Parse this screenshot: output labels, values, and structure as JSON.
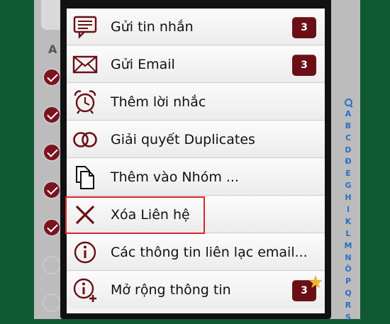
{
  "background": {
    "section_letter": "A"
  },
  "index": [
    "A",
    "B",
    "C",
    "D",
    "Đ",
    "E",
    "G",
    "H",
    "I",
    "K",
    "L",
    "M",
    "N",
    "Ô",
    "P",
    "Q",
    "R",
    "S"
  ],
  "menu": {
    "items": [
      {
        "label": "Gửi tin nhắn",
        "icon": "message-bubble-icon",
        "badge": "3"
      },
      {
        "label": "Gửi Email",
        "icon": "envelope-icon",
        "badge": "3"
      },
      {
        "label": "Thêm lời nhắc",
        "icon": "alarm-clock-icon"
      },
      {
        "label": "Giải quyết Duplicates",
        "icon": "merge-circles-icon"
      },
      {
        "label": "Thêm vào Nhóm ...",
        "icon": "documents-icon"
      },
      {
        "label": "Xóa Liên hệ",
        "icon": "close-x-icon"
      },
      {
        "label": "Các thông tin liên lạc email...",
        "icon": "info-icon"
      },
      {
        "label": "Mở rộng thông tin",
        "icon": "info-plus-icon",
        "badge": "3"
      }
    ]
  },
  "colors": {
    "badge": "#6b0f16",
    "icon": "#6b0f16",
    "highlight": "#d8262c",
    "index": "#2a6fc7",
    "star": "#f0b429"
  }
}
